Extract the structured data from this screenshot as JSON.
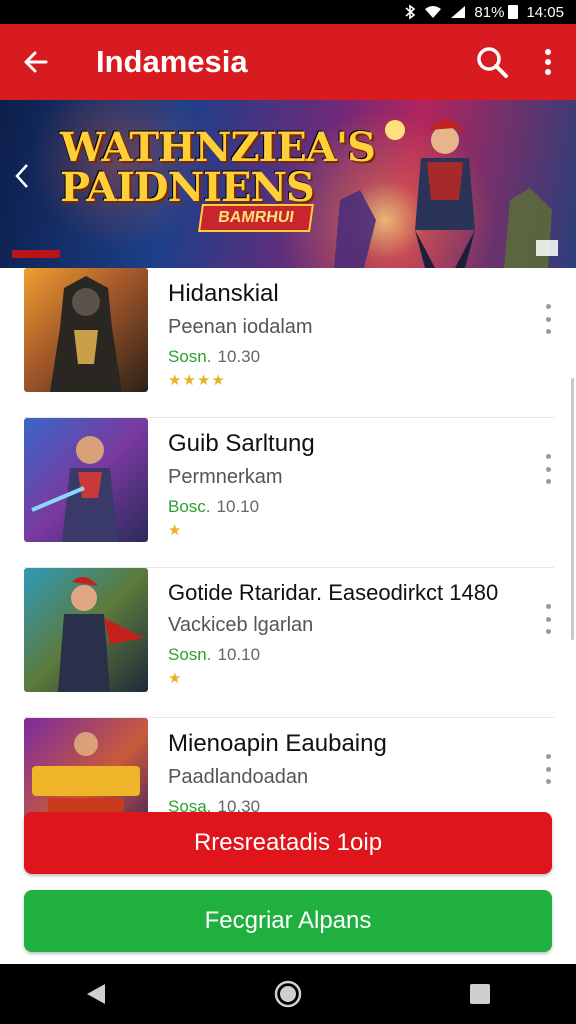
{
  "status_bar": {
    "battery": "81%",
    "time": "14:05"
  },
  "app_bar": {
    "title": "Indamesia"
  },
  "banner": {
    "headline": "WATHNZIEA'S PAIDNIENS",
    "ribbon": "BAMRHUI"
  },
  "apps": [
    {
      "name": "Hidanskial",
      "subtitle": "Peenan iodalam",
      "price": "Sosn.",
      "size": "10.30",
      "stars": "★★★★"
    },
    {
      "name": "Guib Sarltung",
      "subtitle": "Permnerkam",
      "price": "Bosc.",
      "size": "10.10",
      "stars": "★"
    },
    {
      "name": "Gotide Rtaridar. Easeodirkct 1480",
      "subtitle": "Vackiceb lgarlan",
      "price": "Sosn.",
      "size": "10.10",
      "stars": "★"
    },
    {
      "name": "Mienoapin Eaubaing",
      "subtitle": "Paadlandoadan",
      "price": "Sosa.",
      "size": "10.30",
      "stars": ""
    }
  ],
  "buttons": {
    "primary": "Rresreatadis 1oip",
    "secondary": "Fecgriar Alpans"
  },
  "colors": {
    "app_bar": "#d81b20",
    "primary_button": "#e0141b",
    "secondary_button": "#1fb03f",
    "price_text": "#2ca02c",
    "star": "#e6b324"
  },
  "icons": {
    "back": "arrow-left-icon",
    "search": "search-icon",
    "overflow": "more-vert-icon",
    "banner_prev": "chevron-left-icon",
    "nav_back": "triangle-back-icon",
    "nav_home": "circle-home-icon",
    "nav_recents": "square-recents-icon"
  }
}
